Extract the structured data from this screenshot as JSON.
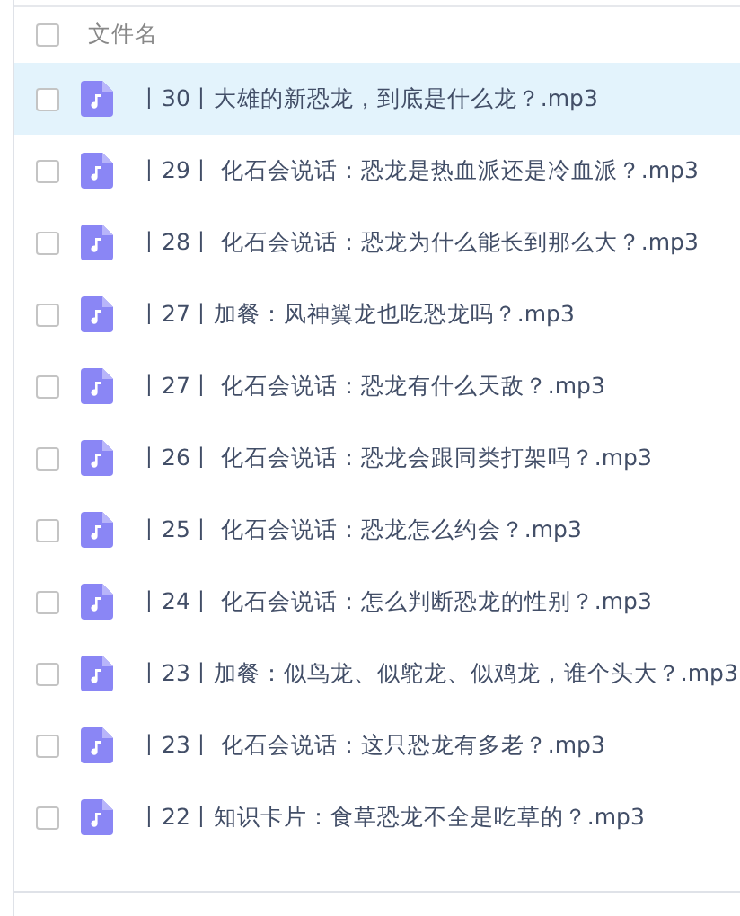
{
  "header": {
    "label": "文件名",
    "checked": false
  },
  "files": [
    {
      "name": "丨30丨大雄的新恐龙，到底是什么龙？.mp3",
      "selected": true,
      "checked": false
    },
    {
      "name": "丨29丨 化石会说话：恐龙是热血派还是冷血派？.mp3",
      "selected": false,
      "checked": false
    },
    {
      "name": "丨28丨 化石会说话：恐龙为什么能长到那么大？.mp3",
      "selected": false,
      "checked": false
    },
    {
      "name": "丨27丨加餐：风神翼龙也吃恐龙吗？.mp3",
      "selected": false,
      "checked": false
    },
    {
      "name": "丨27丨 化石会说话：恐龙有什么天敌？.mp3",
      "selected": false,
      "checked": false
    },
    {
      "name": "丨26丨 化石会说话：恐龙会跟同类打架吗？.mp3",
      "selected": false,
      "checked": false
    },
    {
      "name": "丨25丨 化石会说话：恐龙怎么约会？.mp3",
      "selected": false,
      "checked": false
    },
    {
      "name": "丨24丨 化石会说话：怎么判断恐龙的性别？.mp3",
      "selected": false,
      "checked": false
    },
    {
      "name": "丨23丨加餐：似鸟龙、似鸵龙、似鸡龙，谁个头大？.mp3",
      "selected": false,
      "checked": false
    },
    {
      "name": "丨23丨 化石会说话：这只恐龙有多老？.mp3",
      "selected": false,
      "checked": false
    },
    {
      "name": "丨22丨知识卡片：食草恐龙不全是吃草的？.mp3",
      "selected": false,
      "checked": false
    }
  ]
}
